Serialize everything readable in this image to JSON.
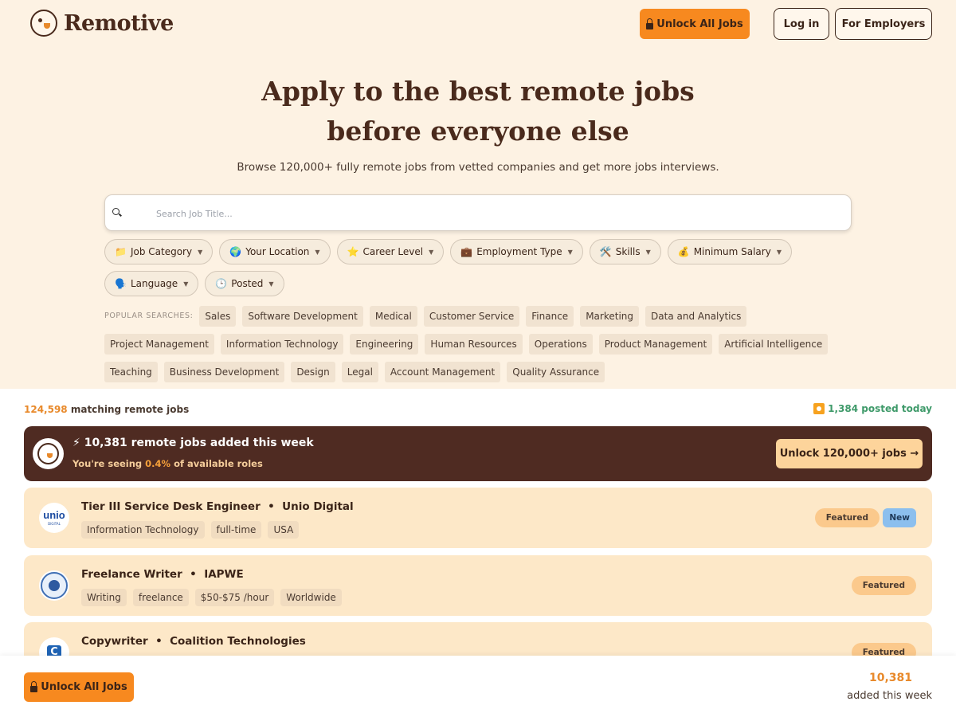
{
  "header": {
    "brand": "Remotive",
    "unlock_label": "Unlock All Jobs",
    "login_label": "Log in",
    "employers_label": "For Employers"
  },
  "hero": {
    "title_line1": "Apply to the best remote jobs",
    "title_line2": "before everyone else",
    "subtitle": "Browse 120,000+ fully remote jobs from vetted companies and get more jobs interviews."
  },
  "search": {
    "placeholder": "Search Job Title..."
  },
  "filters": [
    {
      "emoji": "📁",
      "label": "Job Category"
    },
    {
      "emoji": "🌍",
      "label": "Your Location"
    },
    {
      "emoji": "⭐",
      "label": "Career Level"
    },
    {
      "emoji": "💼",
      "label": "Employment Type"
    },
    {
      "emoji": "🛠️",
      "label": "Skills"
    },
    {
      "emoji": "💰",
      "label": "Minimum Salary"
    },
    {
      "emoji": "🗣️",
      "label": "Language"
    },
    {
      "emoji": "🕒",
      "label": "Posted"
    }
  ],
  "popular": {
    "label": "POPULAR SEARCHES:",
    "tags": [
      "Sales",
      "Software Development",
      "Medical",
      "Customer Service",
      "Finance",
      "Marketing",
      "Data and Analytics",
      "Project Management",
      "Information Technology",
      "Engineering",
      "Human Resources",
      "Operations",
      "Product Management",
      "Artificial Intelligence",
      "Teaching",
      "Business Development",
      "Design",
      "Legal",
      "Account Management",
      "Quality Assurance"
    ]
  },
  "results": {
    "count": "124,598",
    "count_suffix": "matching remote jobs",
    "posted_today": "1,384 posted today"
  },
  "promo": {
    "title": "⚡ 10,381 remote jobs added this week",
    "sub_prefix": "You're seeing ",
    "sub_pct": "0.4%",
    "sub_suffix": " of available roles",
    "button": "Unlock 120,000+ jobs →"
  },
  "jobs": [
    {
      "title": "Tier III Service Desk Engineer",
      "company": "Unio Digital",
      "tags": [
        "Information Technology",
        "full-time",
        "USA"
      ],
      "featured": "Featured",
      "new": "New",
      "logo_text": "unio",
      "logo_sub": "DIGITAL"
    },
    {
      "title": "Freelance Writer",
      "company": "IAPWE",
      "tags": [
        "Writing",
        "freelance",
        "$50-$75 /hour",
        "Worldwide"
      ],
      "featured": "Featured"
    },
    {
      "title": "Copywriter",
      "company": "Coalition Technologies",
      "tags": [],
      "featured": "Featured",
      "logo_text": "C"
    }
  ],
  "sticky": {
    "button": "Unlock All Jobs",
    "number": "10,381",
    "label": "added this week"
  }
}
